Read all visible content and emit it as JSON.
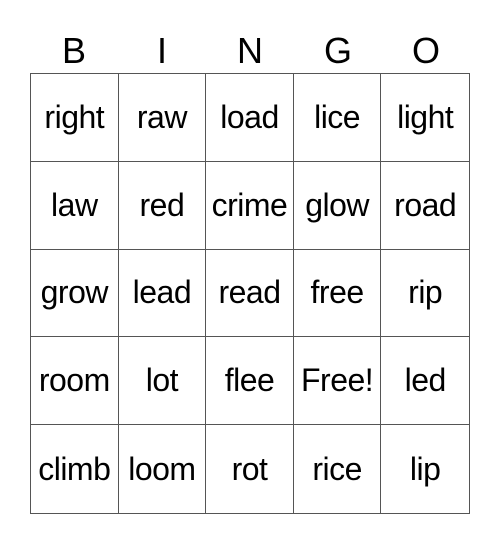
{
  "header": [
    "B",
    "I",
    "N",
    "G",
    "O"
  ],
  "rows": [
    [
      "right",
      "raw",
      "load",
      "lice",
      "light"
    ],
    [
      "law",
      "red",
      "crime",
      "glow",
      "road"
    ],
    [
      "grow",
      "lead",
      "read",
      "free",
      "rip"
    ],
    [
      "room",
      "lot",
      "flee",
      "Free!",
      "led"
    ],
    [
      "climb",
      "loom",
      "rot",
      "rice",
      "lip"
    ]
  ]
}
